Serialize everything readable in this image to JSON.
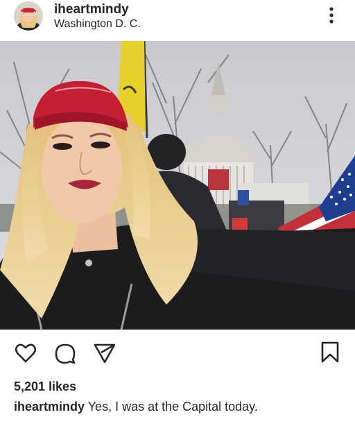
{
  "post": {
    "username": "iheartmindy",
    "location": "Washington D. C.",
    "likes_text": "5,201 likes",
    "caption_user": "iheartmindy",
    "caption_text": " Yes, I was at the Capital today."
  },
  "icons": {
    "more": "more-options-icon",
    "like": "heart-icon",
    "comment": "comment-icon",
    "share": "share-icon",
    "save": "bookmark-icon"
  },
  "colors": {
    "text": "#262626",
    "background": "#ffffff"
  }
}
